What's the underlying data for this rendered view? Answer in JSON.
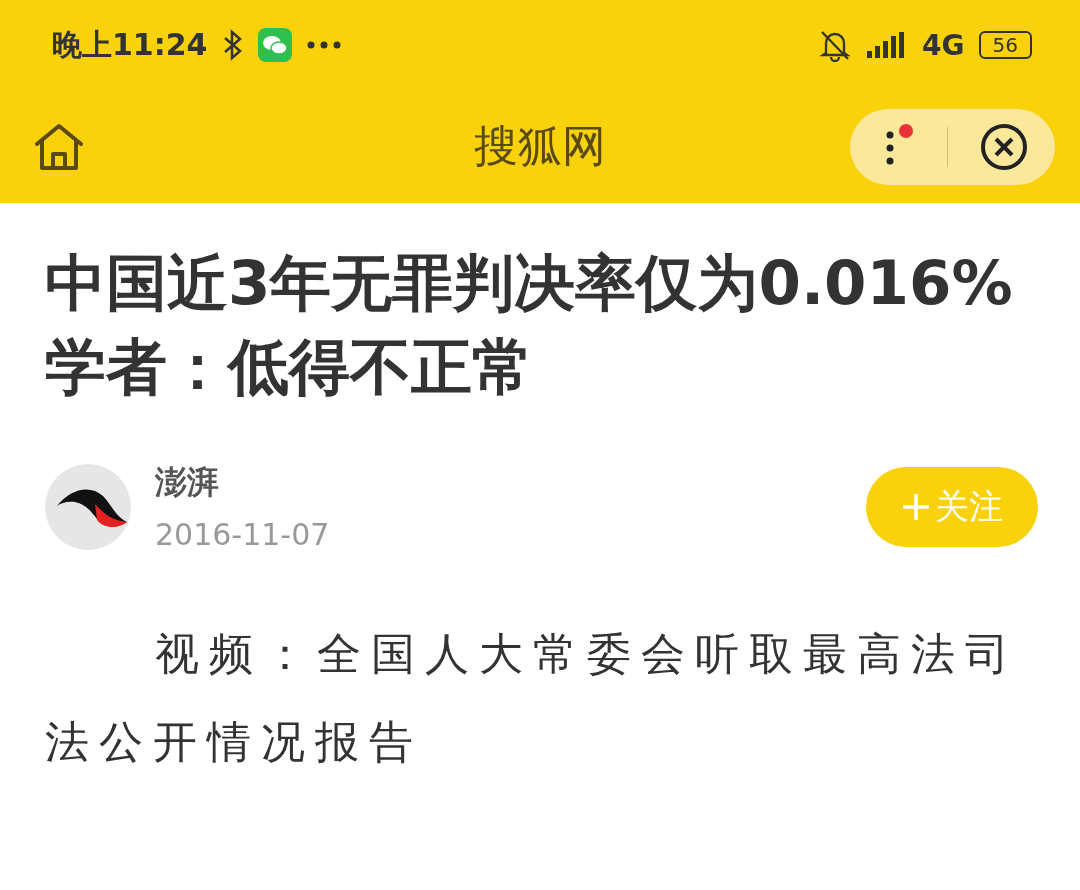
{
  "status_bar": {
    "time": "晚上11:24",
    "network": "4G",
    "battery": "56"
  },
  "nav_bar": {
    "title": "搜狐网",
    "menu_has_notification": true
  },
  "article": {
    "title_lines": [
      "中国近3年无罪判决率仅为0.016%",
      "学者：低得不正常"
    ],
    "author": {
      "name": "澎湃",
      "date": "2016-11-07"
    },
    "follow_button": "关注",
    "body": "视频：全国人大常委会听取最高法司法公开情况报告"
  }
}
